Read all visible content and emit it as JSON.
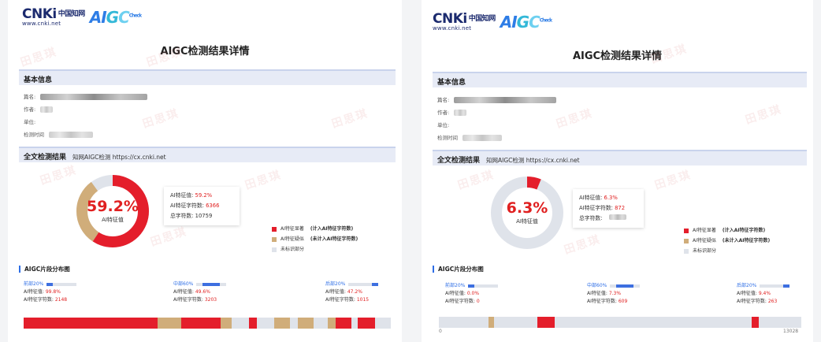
{
  "brand": {
    "cnki": "CNKi",
    "cnki_cn": "中国知网",
    "cnki_url": "www.cnki.net",
    "aigc": "AIGC",
    "aigc_sub": "Check"
  },
  "watermark": "田思琪",
  "colors": {
    "ai_marked": "#e41e2b",
    "ai_suspected": "#d0ad7a",
    "unmarked": "#dfe3ea",
    "accent": "#2e6ee6"
  },
  "labels": {
    "title": "AIGC检测结果详情",
    "basic_section": "基本信息",
    "field_title": "篇名:",
    "field_author": "作者:",
    "field_unit": "单位:",
    "field_time": "检测时间",
    "full_section": "全文检测结果",
    "full_sub": "知网AIGC检测  https://cx.cnki.net",
    "donut_label": "AI特征值",
    "stat_value": "AI特征值:",
    "stat_chars": "AI特征字符数:",
    "stat_total": "总字符数:",
    "legend_marked": "AI特征显著",
    "legend_marked_note": "(计入AI特征字符数)",
    "legend_suspected": "AI特征疑似",
    "legend_suspected_note": "(未计入AI特征字符数)",
    "legend_unmarked": "未标识部分",
    "dist_title": "AIGC片段分布图",
    "seg_value": "AI特征值:",
    "seg_chars": "AI特征字符数:"
  },
  "report_left": {
    "ai_value": "59.2%",
    "ai_chars": "6366",
    "total_chars": "10759",
    "segments": [
      {
        "name": "前部20%",
        "value": "99.8%",
        "chars": "2148"
      },
      {
        "name": "中部60%",
        "value": "49.6%",
        "chars": "3203"
      },
      {
        "name": "后部20%",
        "value": "47.2%",
        "chars": "1015"
      }
    ]
  },
  "report_right": {
    "ai_value": "6.3%",
    "ai_chars": "872",
    "total_chars": "",
    "segments": [
      {
        "name": "前部20%",
        "value": "0.0%",
        "chars": "0"
      },
      {
        "name": "中部60%",
        "value": "7.3%",
        "chars": "609"
      },
      {
        "name": "后部20%",
        "value": "9.4%",
        "chars": "263"
      }
    ],
    "axis_start": "0",
    "axis_end": "13028"
  }
}
